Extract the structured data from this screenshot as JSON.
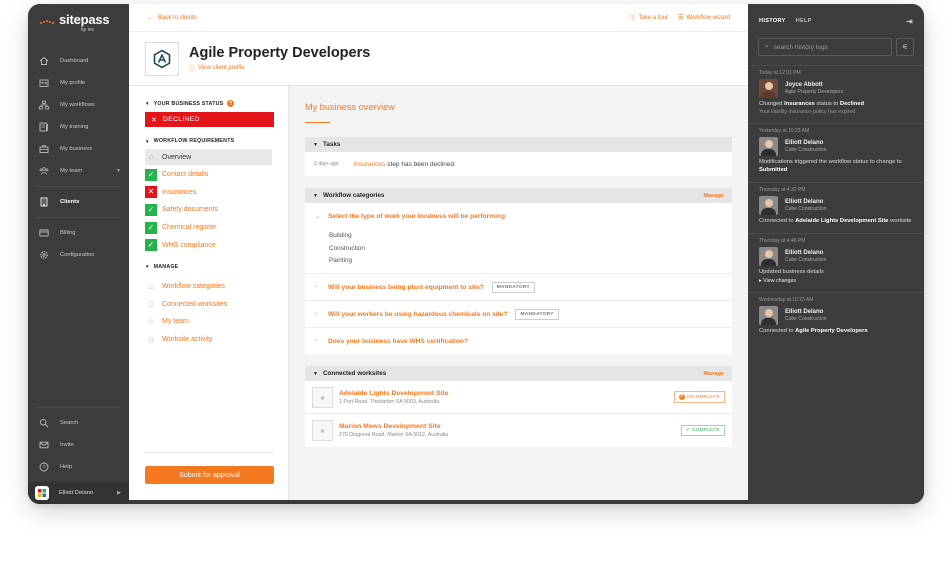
{
  "brand": {
    "name": "sitepass",
    "sub": "by inx",
    "accent": "#f47920"
  },
  "nav": {
    "items": [
      {
        "label": "Dashboard",
        "icon": "home-icon"
      },
      {
        "label": "My profile",
        "icon": "profile-card-icon"
      },
      {
        "label": "My workflows",
        "icon": "workflow-icon"
      },
      {
        "label": "My training",
        "icon": "training-icon"
      },
      {
        "label": "My business",
        "icon": "briefcase-icon"
      },
      {
        "label": "My team",
        "icon": "team-icon"
      },
      {
        "label": "Clients",
        "icon": "building-icon"
      },
      {
        "label": "Billing",
        "icon": "credit-card-icon"
      },
      {
        "label": "Configuration",
        "icon": "gear-icon"
      }
    ],
    "bottom": [
      {
        "label": "Search",
        "icon": "search-icon"
      },
      {
        "label": "Invite",
        "icon": "mail-icon"
      },
      {
        "label": "Help",
        "icon": "help-icon"
      }
    ],
    "user": {
      "name": "Elliott Delano",
      "logo_text": "CUBE"
    }
  },
  "topbar": {
    "back": "Back to clients",
    "tour": "Take a tour",
    "wizard": "Workflow wizard"
  },
  "client": {
    "name": "Agile Property Developers",
    "link": "View client profile"
  },
  "left": {
    "status_heading": "YOUR BUSINESS STATUS",
    "status": "DECLINED",
    "req_heading": "WORKFLOW REQUIREMENTS",
    "overview": "Overview",
    "requirements": [
      {
        "label": "Contact details",
        "state": "ok"
      },
      {
        "label": "Insurances",
        "state": "bad"
      },
      {
        "label": "Safety documents",
        "state": "ok"
      },
      {
        "label": "Chemical register",
        "state": "ok"
      },
      {
        "label": "WHS compliance",
        "state": "ok"
      }
    ],
    "manage_heading": "MANAGE",
    "manage": [
      {
        "label": "Workflow categories",
        "icon": "folder-icon"
      },
      {
        "label": "Connected worksites",
        "icon": "map-icon"
      },
      {
        "label": "My team",
        "icon": "team-icon"
      },
      {
        "label": "Worksite activity",
        "icon": "clock-icon"
      }
    ],
    "submit": "Submit for approval"
  },
  "overview": {
    "title": "My business overview",
    "tasks": {
      "heading": "Tasks",
      "ago": "2 days ago",
      "link": "Insurances",
      "text": "step has been declined"
    },
    "categories": {
      "heading": "Workflow categories",
      "manage": "Manage",
      "q1": "Select the type of work your business will be performing",
      "options": [
        "Building",
        "Construction",
        "Painting"
      ],
      "q2": "Will your business being plant equipment to site?",
      "q3": "Will your workers be using hazardous chemicals on site?",
      "q4": "Does your business have WHS certification?",
      "tag": "MANDATORY"
    },
    "worksites": {
      "heading": "Connected worksites",
      "manage": "Manage",
      "items": [
        {
          "name": "Adelaide Lights Development Site",
          "address": "1 Port Road, Thebarton SA 5003, Australia",
          "status": "INCOMPLETE"
        },
        {
          "name": "Marion Mews Development Site",
          "address": "270 Diagonal Road, Marion SA 5012, Australia",
          "status": "COMPLETE"
        }
      ]
    }
  },
  "history": {
    "tab_history": "HISTORY",
    "tab_help": "HELP",
    "search_placeholder": "search history logs",
    "entries": [
      {
        "ts": "Today at 12:01 PM",
        "name": "Joyce Abbott",
        "company": "Agile Property Developers",
        "msg_pre": "Changed ",
        "msg_b1": "Insurances",
        "msg_mid": " status to ",
        "msg_b2": "Declined",
        "sub": "Your liability insurance policy has expired"
      },
      {
        "ts": "Yesterday at 10:23 AM",
        "name": "Elliott Delano",
        "company": "Cube Construction",
        "msg_pre": "Modifications triggered the workflow status to change to ",
        "msg_b1": "Submitted"
      },
      {
        "ts": "Thursday at 4:32 PM",
        "name": "Elliott Delano",
        "company": "Cube Construction",
        "msg_pre": "Connected to ",
        "msg_b1": "Adelaide Lights Development Site",
        "msg_mid": " worksite"
      },
      {
        "ts": "Thursday at 4:48 PM",
        "name": "Elliott Delano",
        "company": "Cube Construction",
        "msg_pre": "Updated business details",
        "view": "View changes"
      },
      {
        "ts": "Wednesday at 10:23 AM",
        "name": "Elliott Delano",
        "company": "Cube Construction",
        "msg_pre": "Connected to ",
        "msg_b1": "Agile Property Developers"
      }
    ]
  }
}
